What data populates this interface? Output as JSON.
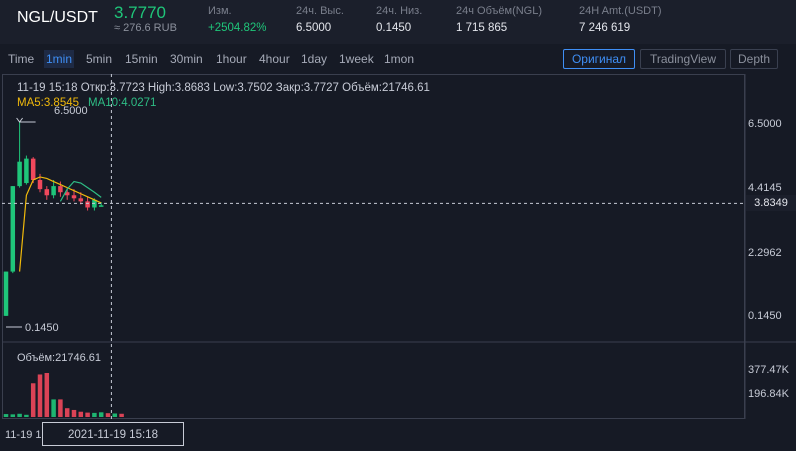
{
  "header": {
    "pair": "NGL/USDT",
    "price": "3.7770",
    "rub": "≈ 276.6 RUB",
    "stats": [
      {
        "label": "Изм.",
        "value": "+2504.82%",
        "green": true
      },
      {
        "label": "24ч. Выс.",
        "value": "6.5000"
      },
      {
        "label": "24ч. Низ.",
        "value": "0.1450"
      },
      {
        "label": "24ч Объём(NGL)",
        "value": "1 715 865"
      },
      {
        "label": "24H Amt.(USDT)",
        "value": "7 246 619"
      }
    ]
  },
  "toolbar": {
    "timeframes": [
      "Time",
      "1min",
      "5min",
      "15min",
      "30min",
      "1hour",
      "4hour",
      "1day",
      "1week",
      "1mon"
    ],
    "active_timeframe": "1min",
    "views": [
      "Оригинал",
      "TradingView",
      "Depth"
    ],
    "active_view": "Оригинал"
  },
  "chart": {
    "info": "11-19 15:18   Откр:3.7723  High:3.8683  Low:3.7502  Закр:3.7727  Объём:21746.61",
    "ma5": "MA5:3.8545",
    "ma10": "MA10:4.0271",
    "high_marker": "6.5000",
    "low_marker": "0.1450",
    "y_ticks": [
      "6.5000",
      "4.4145",
      "2.2962",
      "0.1450"
    ],
    "crosshair_price": "3.8349",
    "volume_label": "Объём:21746.61",
    "volume_ticks": [
      "377.47K",
      "196.84K"
    ],
    "x_label": "11-19 1",
    "crosshair_date": "2021-11-19 15:18"
  },
  "colors": {
    "up": "#1fc67a",
    "down": "#f0485c",
    "ma5": "#f0b90b",
    "ma10": "#2ebd85",
    "accent": "#3f8ff5"
  },
  "chart_data": {
    "type": "candlestick",
    "candles": [
      {
        "o": 0.15,
        "h": 1.6,
        "l": 0.145,
        "c": 1.6
      },
      {
        "o": 1.6,
        "h": 4.4,
        "l": 1.55,
        "c": 4.4
      },
      {
        "o": 4.4,
        "h": 6.5,
        "l": 4.35,
        "c": 5.2
      },
      {
        "o": 4.5,
        "h": 5.4,
        "l": 4.45,
        "c": 5.3
      },
      {
        "o": 5.3,
        "h": 5.35,
        "l": 4.5,
        "c": 4.6
      },
      {
        "o": 4.6,
        "h": 4.8,
        "l": 4.2,
        "c": 4.3
      },
      {
        "o": 4.3,
        "h": 4.4,
        "l": 3.95,
        "c": 4.1
      },
      {
        "o": 4.1,
        "h": 4.6,
        "l": 4.0,
        "c": 4.4
      },
      {
        "o": 4.4,
        "h": 4.55,
        "l": 4.05,
        "c": 4.2
      },
      {
        "o": 4.2,
        "h": 4.35,
        "l": 3.95,
        "c": 4.1
      },
      {
        "o": 4.1,
        "h": 4.3,
        "l": 3.9,
        "c": 4.0
      },
      {
        "o": 4.0,
        "h": 4.2,
        "l": 3.8,
        "c": 3.9
      },
      {
        "o": 3.9,
        "h": 4.05,
        "l": 3.6,
        "c": 3.7
      },
      {
        "o": 3.7,
        "h": 4.0,
        "l": 3.6,
        "c": 3.95
      },
      {
        "o": 3.77,
        "h": 3.87,
        "l": 3.75,
        "c": 3.77
      }
    ],
    "volumes": [
      20,
      18,
      22,
      15,
      230,
      290,
      300,
      120,
      120,
      60,
      48,
      36,
      30,
      28,
      32,
      26,
      24,
      22
    ],
    "ma5": [
      null,
      null,
      1.6,
      4.1,
      4.6,
      4.7,
      4.65,
      4.55,
      4.45,
      4.35,
      4.25,
      4.15,
      4.05,
      3.95,
      3.85
    ],
    "ma10": [
      null,
      null,
      null,
      null,
      null,
      null,
      null,
      null,
      3.9,
      4.3,
      4.55,
      4.5,
      4.35,
      4.2,
      4.03
    ],
    "ylim": [
      0.145,
      6.5
    ]
  }
}
